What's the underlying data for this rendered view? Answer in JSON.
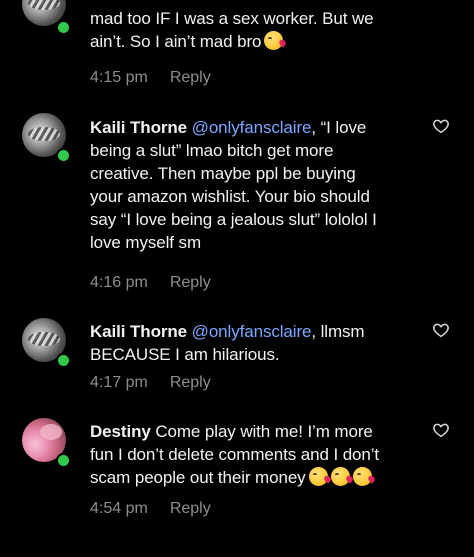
{
  "comments": [
    {
      "avatar": "gray-avatar",
      "name": "",
      "lines": [
        "mad too IF I was a sex worker. But we",
        "ain’t. So I ain’t mad bro"
      ],
      "emoji_count": 1,
      "time": "4:15 pm",
      "reply": "Reply",
      "show_heart": false
    },
    {
      "avatar": "gray-avatar",
      "name": "Kaili Thorne",
      "mention": "@onlyfansclaire",
      "after_mention": ", “I love",
      "lines": [
        "being a slut” lmao bitch get more",
        "creative. Then maybe ppl be buying",
        "your amazon wishlist. Your bio should",
        "say “I love being a jealous slut” lololol I",
        "love myself sm"
      ],
      "time": "4:16 pm",
      "reply": "Reply",
      "show_heart": true
    },
    {
      "avatar": "gray-avatar",
      "name": "Kaili Thorne",
      "mention": "@onlyfansclaire",
      "after_mention": ", llmsm",
      "lines": [
        "BECAUSE I am hilarious."
      ],
      "time": "4:17 pm",
      "reply": "Reply",
      "show_heart": true
    },
    {
      "avatar": "pink-avatar",
      "name": "Destiny",
      "first_text": " Come play with me! I’m more",
      "lines": [
        "fun I don’t delete comments and I don’t",
        "scam people out their money"
      ],
      "emoji_count": 3,
      "time": "4:54 pm",
      "reply": "Reply",
      "show_heart": true
    }
  ],
  "colors": {
    "background": "#000000",
    "text": "#f2f2f2",
    "mention": "#7aa7ff",
    "meta": "#8e8e8e",
    "online": "#32c84b"
  },
  "icons": {
    "heart": "heart-outline-icon",
    "emoji": "kissing-heart-emoji"
  }
}
